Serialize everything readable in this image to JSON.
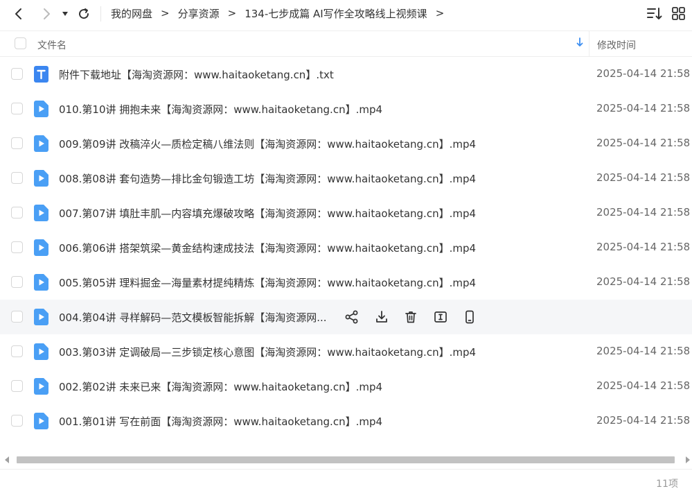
{
  "toolbar": {
    "breadcrumb": [
      {
        "label": "我的网盘"
      },
      {
        "label": "分享资源"
      },
      {
        "label": "134-七步成篇 AI写作全攻略线上视频课"
      }
    ]
  },
  "header": {
    "name_label": "文件名",
    "time_label": "修改时间"
  },
  "files": [
    {
      "name": "附件下载地址【海淘资源网：www.haitaoketang.cn】.txt",
      "time": "2025-04-14 21:58",
      "type": "txt"
    },
    {
      "name": "010.第10讲 拥抱未来【海淘资源网：www.haitaoketang.cn】.mp4",
      "time": "2025-04-14 21:58",
      "type": "video"
    },
    {
      "name": "009.第09讲 改稿淬火—质检定稿八维法则【海淘资源网：www.haitaoketang.cn】.mp4",
      "time": "2025-04-14 21:58",
      "type": "video"
    },
    {
      "name": "008.第08讲 套句造势—排比金句锻造工坊【海淘资源网：www.haitaoketang.cn】.mp4",
      "time": "2025-04-14 21:58",
      "type": "video"
    },
    {
      "name": "007.第07讲 填肚丰肌—内容填充爆破攻略【海淘资源网：www.haitaoketang.cn】.mp4",
      "time": "2025-04-14 21:58",
      "type": "video"
    },
    {
      "name": "006.第06讲 搭架筑梁—黄金结构速成技法【海淘资源网：www.haitaoketang.cn】.mp4",
      "time": "2025-04-14 21:58",
      "type": "video"
    },
    {
      "name": "005.第05讲 理料掘金—海量素材提纯精炼【海淘资源网：www.haitaoketang.cn】.mp4",
      "time": "2025-04-14 21:58",
      "type": "video"
    },
    {
      "name": "004.第04讲 寻样解码—范文模板智能拆解【海淘资源网...",
      "time": "",
      "type": "video",
      "hover": true
    },
    {
      "name": "003.第03讲 定调破局—三步锁定核心意图【海淘资源网：www.haitaoketang.cn】.mp4",
      "time": "2025-04-14 21:58",
      "type": "video"
    },
    {
      "name": "002.第02讲 未来已来【海淘资源网：www.haitaoketang.cn】.mp4",
      "time": "2025-04-14 21:58",
      "type": "video"
    },
    {
      "name": "001.第01讲 写在前面【海淘资源网：www.haitaoketang.cn】.mp4",
      "time": "2025-04-14 21:58",
      "type": "video"
    }
  ],
  "hover_actions": [
    "share-icon",
    "download-icon",
    "delete-icon",
    "rename-icon",
    "mobile-icon"
  ],
  "footer": {
    "count": "11项"
  },
  "colors": {
    "accent": "#3d8ef0",
    "video_icon": "#4a9ff5",
    "txt_icon": "#3b86f0"
  }
}
